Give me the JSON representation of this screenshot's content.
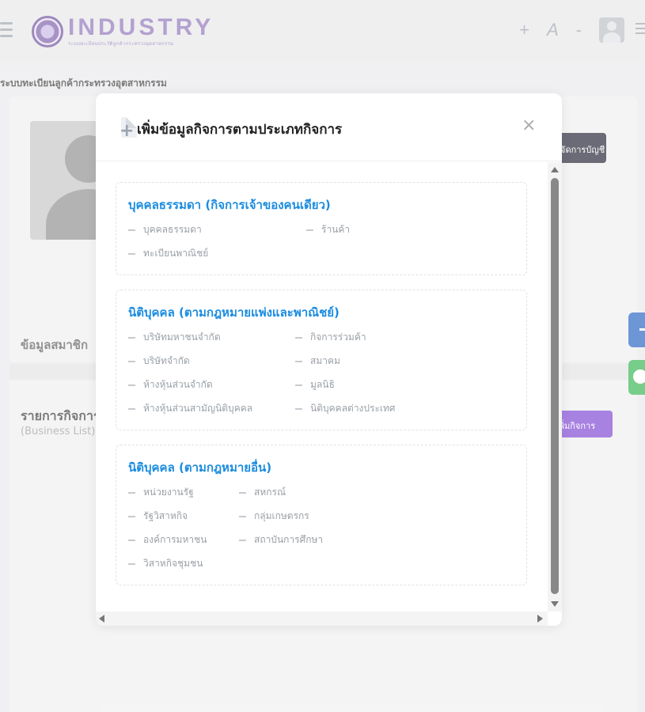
{
  "header": {
    "logo_title": "INDUSTRY",
    "logo_subtitle": "ระบบทะเบียนประวัติลูกค้ากระทรวงอุตสาหกรรม",
    "font_increase": "+",
    "font_label": "A",
    "font_decrease": "-"
  },
  "breadcrumb": "ระบบทะเบียนลูกค้ากระทรวงอุตสาหกรรม",
  "profile": {
    "account_button": "จัดการบัญชี",
    "members_section": "ข้อมูลสมาชิก"
  },
  "business": {
    "title": "รายการกิจการ",
    "subtitle": "(Business List)",
    "add_button": "เพิ่มกิจการ"
  },
  "modal": {
    "title": "เพิ่มข้อมูลกิจการตามประเภทกิจการ",
    "close": "×",
    "groups": [
      {
        "title": "บุคคลธรรมดา (กิจการเจ้าของคนเดียว)",
        "items": [
          "บุคคลธรรมดา",
          "ร้านค้า",
          "ทะเบียนพาณิชย์"
        ]
      },
      {
        "title": "นิติบุคคล (ตามกฎหมายแพ่งและพาณิชย์)",
        "items": [
          "บริษัทมหาชนจำกัด",
          "กิจการร่วมค้า",
          "บริษัทจำกัด",
          "สมาคม",
          "ห้างหุ้นส่วนจำกัด",
          "มูลนิธิ",
          "ห้างหุ้นส่วนสามัญนิติบุคคล",
          "นิติบุคคลต่างประเทศ"
        ]
      },
      {
        "title": "นิติบุคคล (ตามกฎหมายอื่น)",
        "items": [
          "หน่วยงานรัฐ",
          "สหกรณ์",
          "รัฐวิสาหกิจ",
          "กลุ่มเกษตรกร",
          "องค์การมหาชน",
          "สถาบันการศึกษา",
          "วิสาหกิจชุมชน"
        ]
      }
    ]
  },
  "colors": {
    "group_title": "#1a8ce0",
    "add_button": "#7a3fd1",
    "account_button": "#1c1d2e"
  }
}
